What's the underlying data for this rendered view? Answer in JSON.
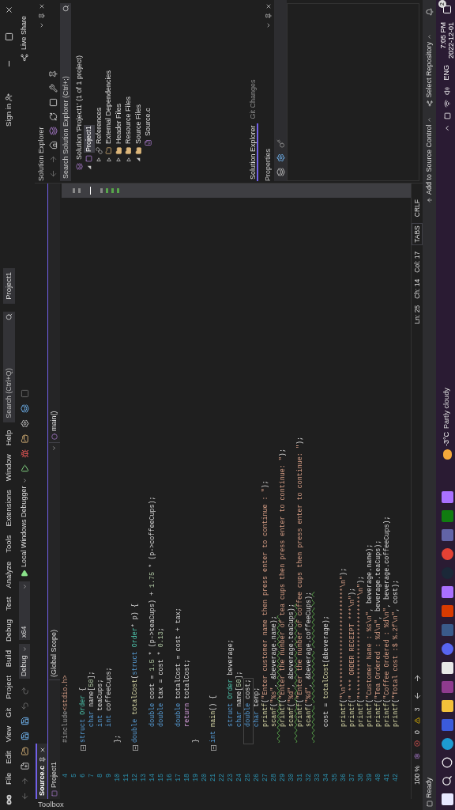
{
  "title_bar": {
    "menu": [
      "File",
      "Edit",
      "View",
      "Git",
      "Project",
      "Build",
      "Debug",
      "Test",
      "Analyze",
      "Tools",
      "Extensions",
      "Window",
      "Help"
    ],
    "search": {
      "placeholder": "Search (Ctrl+Q)"
    },
    "solution_name": "Project1",
    "sign_in": "Sign in",
    "live_share": "Live Share"
  },
  "toolbar": {
    "configuration": "Debug",
    "platform": "x64",
    "debugger": "Local Windows Debugger"
  },
  "toolbox": {
    "label": "Toolbox"
  },
  "editor": {
    "tabs": [
      {
        "label": "Source.c",
        "selected": true
      }
    ],
    "nav": {
      "project": "Project1",
      "scope": "(Global Scope)",
      "member": "main()"
    },
    "lines": [
      {
        "number": "4",
        "fold": false,
        "current": false,
        "warning": false,
        "tokens": [
          {
            "kind": "pre",
            "text": "#include"
          },
          {
            "kind": "str",
            "text": "<stdio.h>"
          }
        ]
      },
      {
        "number": "5",
        "fold": false
      },
      {
        "number": "6",
        "fold": true,
        "current": false,
        "warning": false,
        "tokens": [
          {
            "kind": "kw",
            "text": "struct"
          },
          {
            "kind": "type",
            "text": " Order"
          },
          {
            "kind": "p",
            "text": " {"
          }
        ]
      },
      {
        "number": "7",
        "fold": false,
        "current": false,
        "warning": false,
        "tokens": [
          {
            "kind": "kw",
            "text": "    char"
          },
          {
            "kind": "p",
            "text": " name["
          },
          {
            "kind": "num",
            "text": "50"
          },
          {
            "kind": "p",
            "text": "];"
          }
        ]
      },
      {
        "number": "8",
        "fold": false,
        "current": false,
        "warning": false,
        "tokens": [
          {
            "kind": "kw",
            "text": "    int"
          },
          {
            "kind": "p",
            "text": " teaCups;"
          }
        ]
      },
      {
        "number": "9",
        "fold": false,
        "current": false,
        "warning": false,
        "tokens": [
          {
            "kind": "kw",
            "text": "    int"
          },
          {
            "kind": "p",
            "text": " coffeeCups;"
          }
        ]
      },
      {
        "number": "10",
        "fold": false,
        "current": false,
        "warning": false,
        "tokens": [
          {
            "kind": "p",
            "text": "};"
          }
        ]
      },
      {
        "number": "11",
        "fold": false
      },
      {
        "number": "12",
        "fold": true,
        "current": false,
        "warning": false,
        "tokens": [
          {
            "kind": "kw",
            "text": "double"
          },
          {
            "kind": "fn",
            "text": " totalCost"
          },
          {
            "kind": "p",
            "text": "("
          },
          {
            "kind": "kw",
            "text": "struct"
          },
          {
            "kind": "type",
            "text": " Order"
          },
          {
            "kind": "p",
            "text": "* p) {"
          }
        ]
      },
      {
        "number": "13",
        "fold": false
      },
      {
        "number": "14",
        "fold": false,
        "current": false,
        "warning": false,
        "tokens": [
          {
            "kind": "kw",
            "text": "    double"
          },
          {
            "kind": "p",
            "text": " cost = "
          },
          {
            "kind": "num",
            "text": "1.5"
          },
          {
            "kind": "p",
            "text": " * (p->teaCups) + "
          },
          {
            "kind": "num",
            "text": "1.75"
          },
          {
            "kind": "p",
            "text": " * (p->coffeeCups);"
          }
        ]
      },
      {
        "number": "15",
        "fold": false,
        "current": false,
        "warning": false,
        "tokens": [
          {
            "kind": "kw",
            "text": "    double"
          },
          {
            "kind": "p",
            "text": " tax = cost * "
          },
          {
            "kind": "num",
            "text": "0.13"
          },
          {
            "kind": "p",
            "text": ";"
          }
        ]
      },
      {
        "number": "16",
        "fold": false
      },
      {
        "number": "17",
        "fold": false,
        "current": false,
        "warning": false,
        "tokens": [
          {
            "kind": "kw",
            "text": "    double"
          },
          {
            "kind": "p",
            "text": " totalCost = cost + tax;"
          }
        ]
      },
      {
        "number": "18",
        "fold": false,
        "current": false,
        "warning": false,
        "tokens": [
          {
            "kind": "ctl",
            "text": "    return"
          },
          {
            "kind": "p",
            "text": " totalCost;"
          }
        ]
      },
      {
        "number": "19",
        "fold": false,
        "current": false,
        "warning": false,
        "tokens": [
          {
            "kind": "p",
            "text": "}"
          }
        ]
      },
      {
        "number": "20",
        "fold": false
      },
      {
        "number": "21",
        "fold": true,
        "current": false,
        "warning": false,
        "tokens": [
          {
            "kind": "kw",
            "text": "int"
          },
          {
            "kind": "fn",
            "text": " main"
          },
          {
            "kind": "p",
            "text": "() {"
          }
        ]
      },
      {
        "number": "22",
        "fold": false
      },
      {
        "number": "23",
        "fold": false,
        "current": false,
        "warning": false,
        "tokens": [
          {
            "kind": "kw",
            "text": "    struct"
          },
          {
            "kind": "type",
            "text": " Order"
          },
          {
            "kind": "p",
            "text": " beverage;"
          }
        ]
      },
      {
        "number": "24",
        "fold": false,
        "current": false,
        "warning": false,
        "tokens": [
          {
            "kind": "kw",
            "text": "    char"
          },
          {
            "kind": "p",
            "text": " name["
          },
          {
            "kind": "num",
            "text": "50"
          },
          {
            "kind": "p",
            "text": "];"
          }
        ]
      },
      {
        "number": "25",
        "fold": false,
        "current": true,
        "warning": false,
        "tokens": [
          {
            "kind": "kw",
            "text": "    double"
          },
          {
            "kind": "p",
            "text": " cost;"
          }
        ]
      },
      {
        "number": "26",
        "fold": false,
        "current": false,
        "warning": false,
        "tokens": [
          {
            "kind": "kw",
            "text": "    char"
          },
          {
            "kind": "p",
            "text": " temp;"
          }
        ]
      },
      {
        "number": "27",
        "fold": false,
        "current": false,
        "warning": false,
        "tokens": [
          {
            "kind": "fn",
            "text": "    printf"
          },
          {
            "kind": "p",
            "text": "("
          },
          {
            "kind": "str",
            "text": "\"Enter customer name then press enter to continue : \""
          },
          {
            "kind": "p",
            "text": ");"
          }
        ]
      },
      {
        "number": "28",
        "fold": false,
        "current": false,
        "warning": true,
        "tokens": [
          {
            "kind": "fn",
            "text": "    scanf"
          },
          {
            "kind": "p",
            "text": "("
          },
          {
            "kind": "str",
            "text": "\"%s\""
          },
          {
            "kind": "p",
            "text": ", &beverage.name);"
          }
        ]
      },
      {
        "number": "29",
        "fold": false,
        "current": false,
        "warning": false,
        "tokens": [
          {
            "kind": "fn",
            "text": "    printf"
          },
          {
            "kind": "p",
            "text": "("
          },
          {
            "kind": "str",
            "text": "\"Enter the number of tea cups then press enter to continue: \""
          },
          {
            "kind": "p",
            "text": ");"
          }
        ]
      },
      {
        "number": "30",
        "fold": false,
        "current": false,
        "warning": true,
        "tokens": [
          {
            "kind": "fn",
            "text": "    scanf"
          },
          {
            "kind": "p",
            "text": "("
          },
          {
            "kind": "str",
            "text": "\"%d\""
          },
          {
            "kind": "p",
            "text": ", &beverage.teaCups);"
          }
        ]
      },
      {
        "number": "31",
        "fold": false,
        "current": false,
        "warning": false,
        "tokens": [
          {
            "kind": "fn",
            "text": "    printf"
          },
          {
            "kind": "p",
            "text": "("
          },
          {
            "kind": "str",
            "text": "\"Enter the number of coffee cups then press enter to continue: \""
          },
          {
            "kind": "p",
            "text": ");"
          }
        ]
      },
      {
        "number": "32",
        "fold": false,
        "current": false,
        "warning": true,
        "tokens": [
          {
            "kind": "fn",
            "text": "    scanf"
          },
          {
            "kind": "p",
            "text": "("
          },
          {
            "kind": "str",
            "text": "\"%d\""
          },
          {
            "kind": "p",
            "text": ", &beverage.coffeeCups);"
          }
        ]
      },
      {
        "number": "33",
        "fold": false
      },
      {
        "number": "34",
        "fold": false,
        "current": false,
        "warning": false,
        "tokens": [
          {
            "kind": "p",
            "text": "    cost = "
          },
          {
            "kind": "fn",
            "text": "totalCost"
          },
          {
            "kind": "p",
            "text": "(&beverage);"
          }
        ]
      },
      {
        "number": "35",
        "fold": false
      },
      {
        "number": "36",
        "fold": false,
        "current": false,
        "warning": false,
        "tokens": [
          {
            "kind": "fn",
            "text": "    printf"
          },
          {
            "kind": "p",
            "text": "("
          },
          {
            "kind": "str",
            "text": "\"\\n*************************\\n\""
          },
          {
            "kind": "p",
            "text": ");"
          }
        ]
      },
      {
        "number": "37",
        "fold": false,
        "current": false,
        "warning": false,
        "tokens": [
          {
            "kind": "fn",
            "text": "    printf"
          },
          {
            "kind": "p",
            "text": "("
          },
          {
            "kind": "str",
            "text": "\" *** ORDER RECEIPT ***\\n\""
          },
          {
            "kind": "p",
            "text": ");"
          }
        ]
      },
      {
        "number": "38",
        "fold": false,
        "current": false,
        "warning": false,
        "tokens": [
          {
            "kind": "fn",
            "text": "    printf"
          },
          {
            "kind": "p",
            "text": "("
          },
          {
            "kind": "str",
            "text": "\"*************************\\n\""
          },
          {
            "kind": "p",
            "text": ");"
          }
        ]
      },
      {
        "number": "39",
        "fold": false,
        "current": false,
        "warning": false,
        "tokens": [
          {
            "kind": "fn",
            "text": "    printf"
          },
          {
            "kind": "p",
            "text": "("
          },
          {
            "kind": "str",
            "text": "\"Customer Name : %s\\n\""
          },
          {
            "kind": "p",
            "text": ", beverage.name);"
          }
        ]
      },
      {
        "number": "40",
        "fold": false,
        "current": false,
        "warning": false,
        "tokens": [
          {
            "kind": "fn",
            "text": "    printf"
          },
          {
            "kind": "p",
            "text": "("
          },
          {
            "kind": "str",
            "text": "\"Tea Ordered : %d\\n\""
          },
          {
            "kind": "p",
            "text": ", beverage.teaCups);"
          }
        ]
      },
      {
        "number": "41",
        "fold": false,
        "current": false,
        "warning": false,
        "tokens": [
          {
            "kind": "fn",
            "text": "    printf"
          },
          {
            "kind": "p",
            "text": "("
          },
          {
            "kind": "str",
            "text": "\"Coffee Ordered : %d\\n\""
          },
          {
            "kind": "p",
            "text": ", beverage.coffeeCups);"
          }
        ]
      },
      {
        "number": "42",
        "fold": false,
        "current": false,
        "warning": false,
        "tokens": [
          {
            "kind": "fn",
            "text": "    printf"
          },
          {
            "kind": "p",
            "text": "("
          },
          {
            "kind": "str",
            "text": "\"Total cost :$ %.2f\\n\""
          },
          {
            "kind": "p",
            "text": ", cost);"
          }
        ]
      }
    ],
    "status": {
      "zoom": "100 %",
      "errors": "0",
      "warnings": "3",
      "line": "Ln: 25",
      "char": "Ch: 14",
      "col": "Col: 17",
      "indent": "TABS",
      "line_ending": "CRLF"
    }
  },
  "solution_explorer": {
    "title": "Solution Explorer",
    "search": {
      "placeholder": "Search Solution Explorer (Ctrl+;)"
    },
    "tree": [
      {
        "label": "Solution 'Project1' (1 of 1 project)",
        "kind": "solution",
        "selected": false,
        "children": [
          {
            "label": "Project1",
            "kind": "project",
            "selected": true,
            "expanded": true,
            "children": [
              {
                "label": "References",
                "kind": "references",
                "selected": false,
                "expanded": false
              },
              {
                "label": "External Dependencies",
                "kind": "dependencies",
                "selected": false,
                "expanded": false
              },
              {
                "label": "Header Files",
                "kind": "folder",
                "selected": false,
                "expanded": false
              },
              {
                "label": "Resource Files",
                "kind": "folder",
                "selected": false,
                "expanded": false
              },
              {
                "label": "Source Files",
                "kind": "folder",
                "selected": false,
                "expanded": true,
                "children": [
                  {
                    "label": "Source.c",
                    "kind": "file",
                    "selected": false
                  }
                ]
              }
            ]
          }
        ]
      }
    ],
    "tabs": [
      {
        "label": "Solution Explorer",
        "selected": true
      },
      {
        "label": "Git Changes",
        "selected": false
      }
    ]
  },
  "properties": {
    "title": "Properties"
  },
  "status_bar": {
    "state": "Ready",
    "source_control": "Add to Source Control",
    "repository": "Select Repository"
  },
  "taskbar": {
    "weather": "-3°C",
    "weather_text": "Partly cloudy",
    "language": "ENG",
    "time": "7:05 PM",
    "date": "2022-12-01",
    "notifications": "2"
  }
}
